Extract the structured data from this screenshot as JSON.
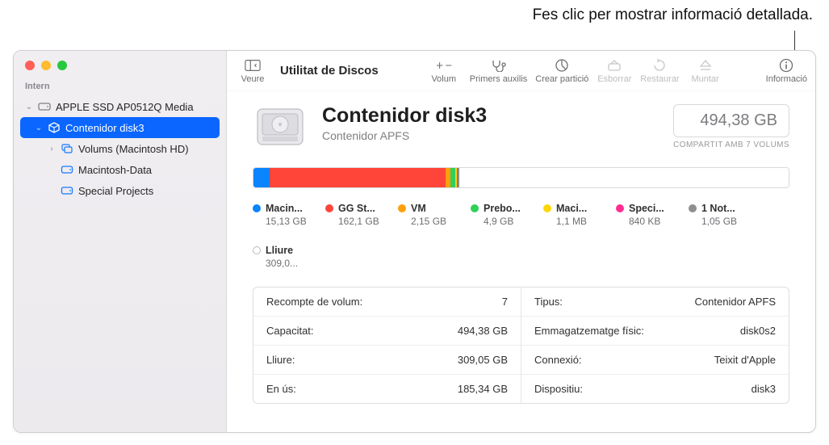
{
  "callout": "Fes clic per mostrar informació detallada.",
  "sidebar": {
    "section": "Intern",
    "items": [
      {
        "label": "APPLE SSD AP0512Q Media"
      },
      {
        "label": "Contenidor disk3"
      },
      {
        "label": "Volums (Macintosh HD)"
      },
      {
        "label": "Macintosh-Data"
      },
      {
        "label": "Special Projects"
      }
    ]
  },
  "toolbar": {
    "appTitle": "Utilitat de Discos",
    "veure": "Veure",
    "volum": "Volum",
    "primersAuxilis": "Primers auxilis",
    "crearParticio": "Crear partició",
    "esborrar": "Esborrar",
    "restaurar": "Restaurar",
    "muntar": "Muntar",
    "informacio": "Informació"
  },
  "header": {
    "title": "Contenidor disk3",
    "subtitle": "Contenidor APFS",
    "capacity": "494,38 GB",
    "shared": "COMPARTIT AMB 7 VOLUMS"
  },
  "segments": [
    {
      "name": "Macin...",
      "size": "15,13 GB",
      "color": "#0a84ff",
      "pct": 3.06
    },
    {
      "name": "GG St...",
      "size": "162,1 GB",
      "color": "#ff453a",
      "pct": 32.8
    },
    {
      "name": "VM",
      "size": "2,15 GB",
      "color": "#ff9f0a",
      "pct": 0.9
    },
    {
      "name": "Prebo...",
      "size": "4,9 GB",
      "color": "#30d158",
      "pct": 1.0
    },
    {
      "name": "Maci...",
      "size": "1,1 MB",
      "color": "#ffd60a",
      "pct": 0.2
    },
    {
      "name": "Speci...",
      "size": "840 KB",
      "color": "#ff2d91",
      "pct": 0.2
    },
    {
      "name": "1 Not...",
      "size": "1,05 GB",
      "color": "#8e8e93",
      "pct": 0.3
    },
    {
      "name": "Lliure",
      "size": "309,0...",
      "color": "open",
      "pct": 61.54
    }
  ],
  "infoLeft": [
    {
      "k": "Recompte de volum:",
      "v": "7"
    },
    {
      "k": "Capacitat:",
      "v": "494,38 GB"
    },
    {
      "k": "Lliure:",
      "v": "309,05 GB"
    },
    {
      "k": "En ús:",
      "v": "185,34 GB"
    }
  ],
  "infoRight": [
    {
      "k": "Tipus:",
      "v": "Contenidor APFS"
    },
    {
      "k": "Emmagatzematge físic:",
      "v": "disk0s2"
    },
    {
      "k": "Connexió:",
      "v": "Teixit d'Apple"
    },
    {
      "k": "Dispositiu:",
      "v": "disk3"
    }
  ]
}
